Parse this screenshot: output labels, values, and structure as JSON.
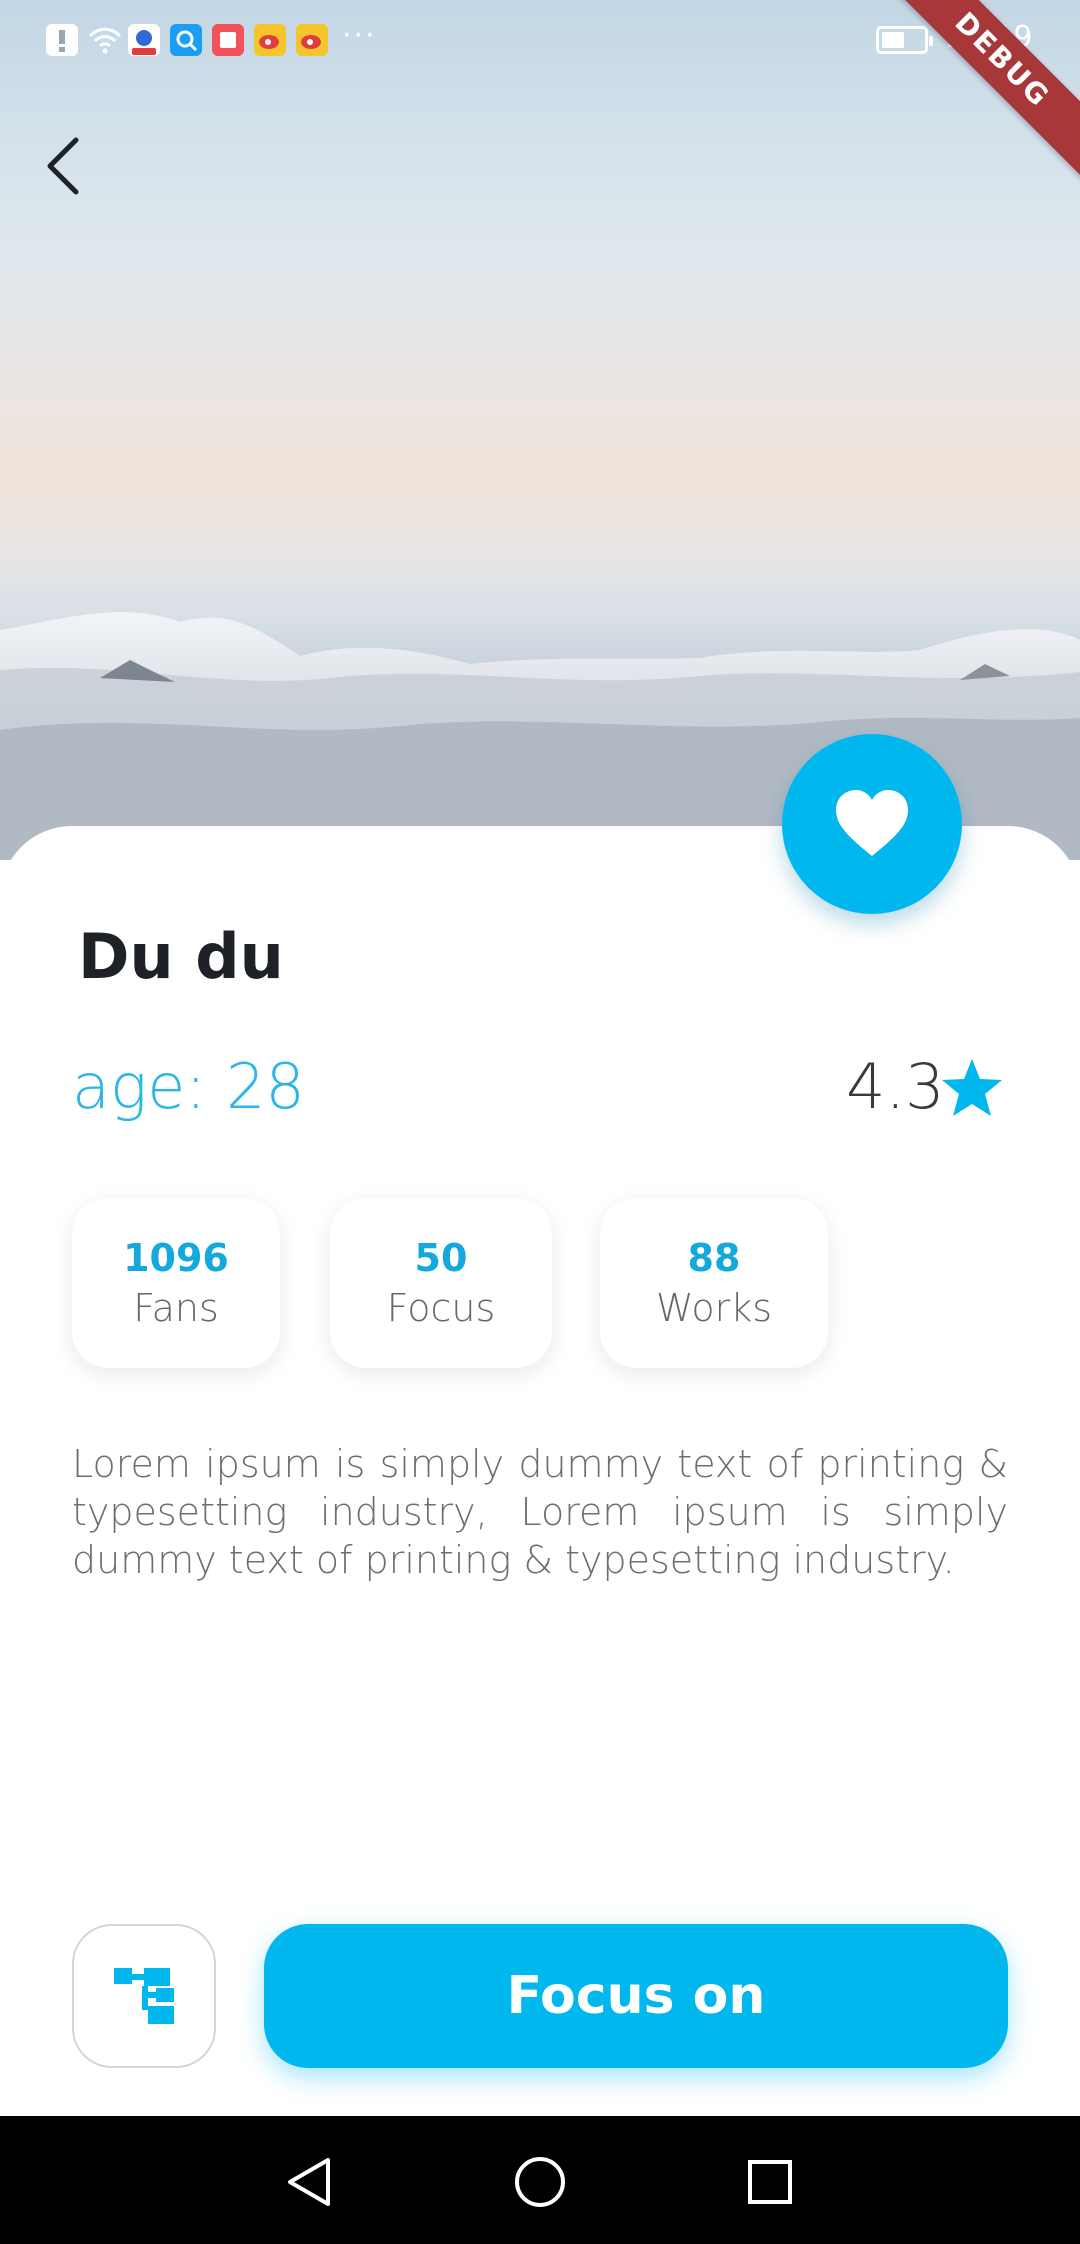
{
  "status_bar": {
    "time": "22:19",
    "debug_label": "DEBUG",
    "battery_level": 0.55,
    "overflow_indicator": "···",
    "notification_icons": [
      "alert-icon",
      "wifi-icon",
      "baidu-app-icon",
      "search-app-icon",
      "notes-app-icon",
      "weibo-app-icon",
      "weibo-app-icon"
    ]
  },
  "header": {
    "back_icon": "chevron-left-icon"
  },
  "profile": {
    "name": "Du du",
    "age": "age: 28",
    "rating": "4.3",
    "rating_icon": "star-icon",
    "favorite_icon": "heart-icon",
    "stats": [
      {
        "value": "1096",
        "label": "Fans"
      },
      {
        "value": "50",
        "label": "Focus"
      },
      {
        "value": "88",
        "label": "Works"
      }
    ],
    "description": "Lorem ipsum is simply dummy text of printing & typesetting industry, Lorem ipsum is simply dummy text of printing & typesetting industry."
  },
  "actions": {
    "share_icon": "hierarchy-icon",
    "focus_label": "Focus on"
  },
  "nav_bar": {
    "icons": [
      "back-triangle-icon",
      "home-circle-icon",
      "recents-square-icon"
    ]
  },
  "colors": {
    "accent": "#00b7ee",
    "accent_text": "#2cb6e6",
    "debug_ribbon": "#a8373a"
  }
}
